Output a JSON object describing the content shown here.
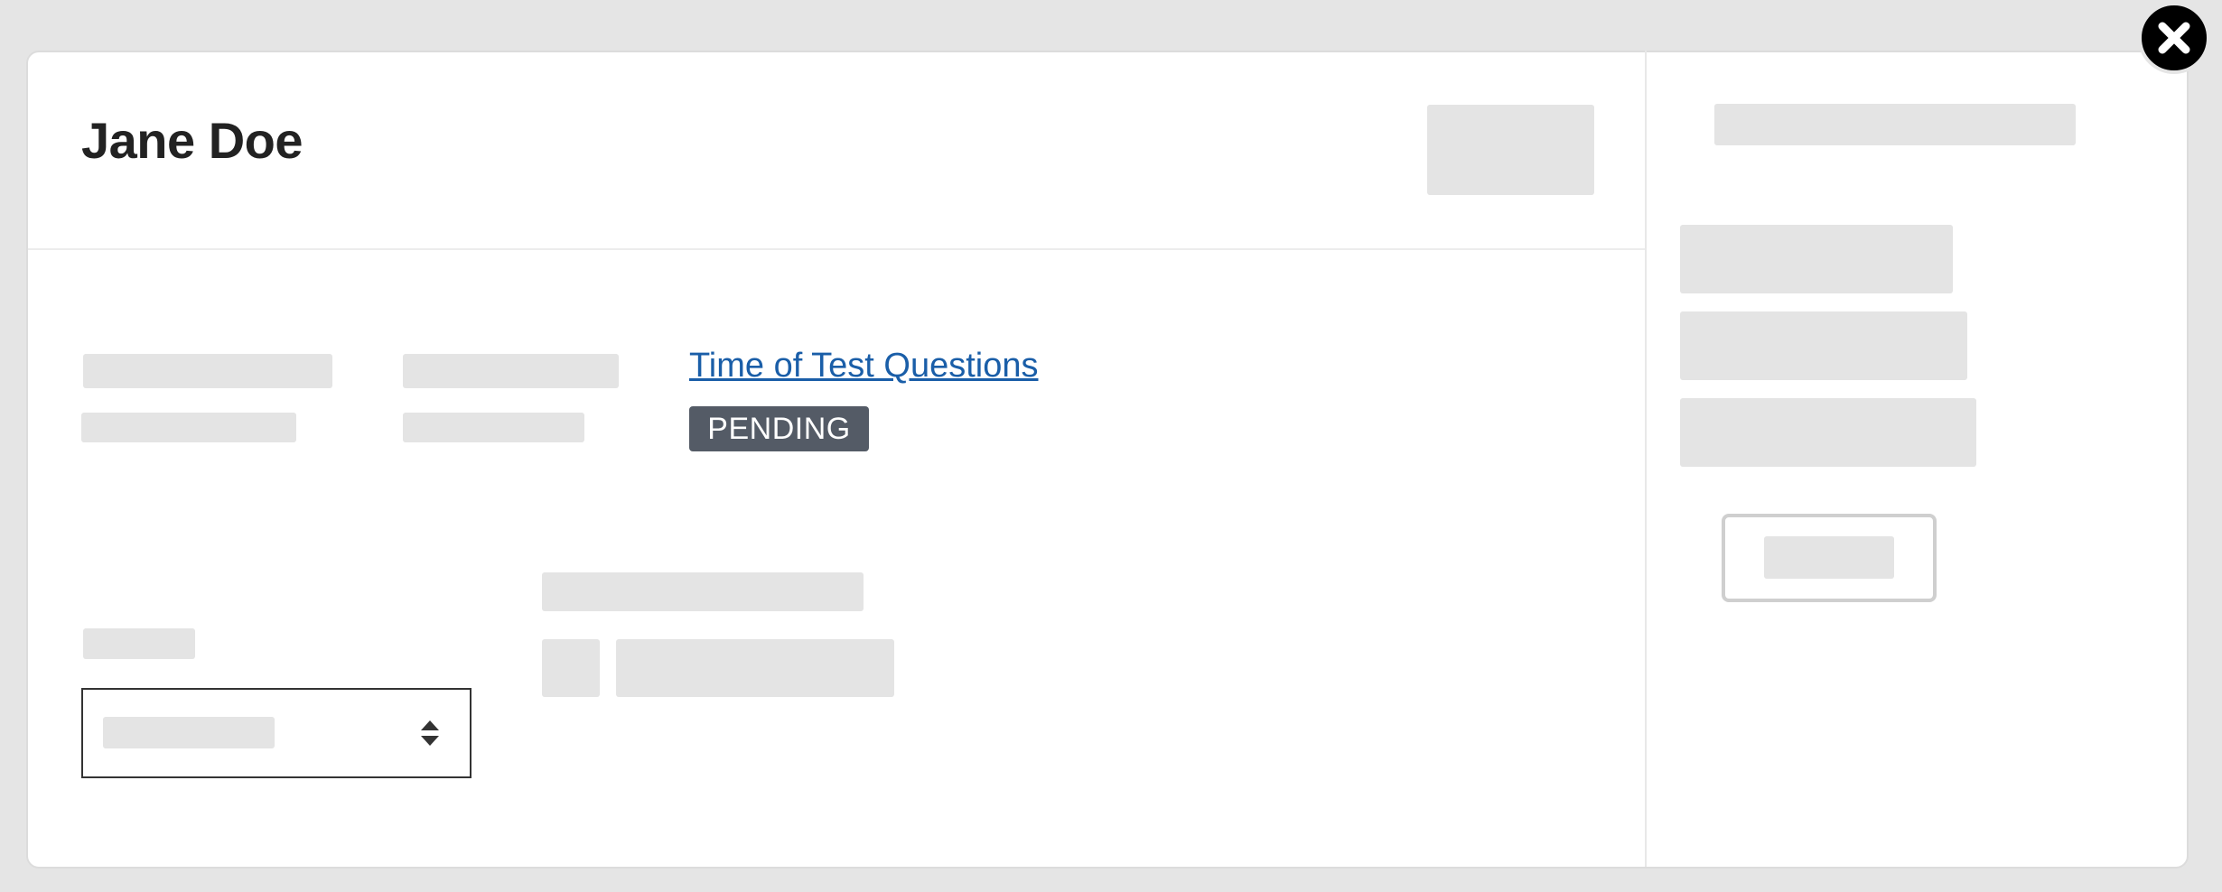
{
  "modal": {
    "title": "Jane Doe",
    "test_link_label": "Time of Test Questions",
    "status_badge": "PENDING"
  },
  "colors": {
    "link": "#1a5ea8",
    "badge_background": "#545b66",
    "placeholder": "#e4e4e4"
  },
  "icons": {
    "close": "close-icon",
    "select": "sort-arrows-icon"
  }
}
